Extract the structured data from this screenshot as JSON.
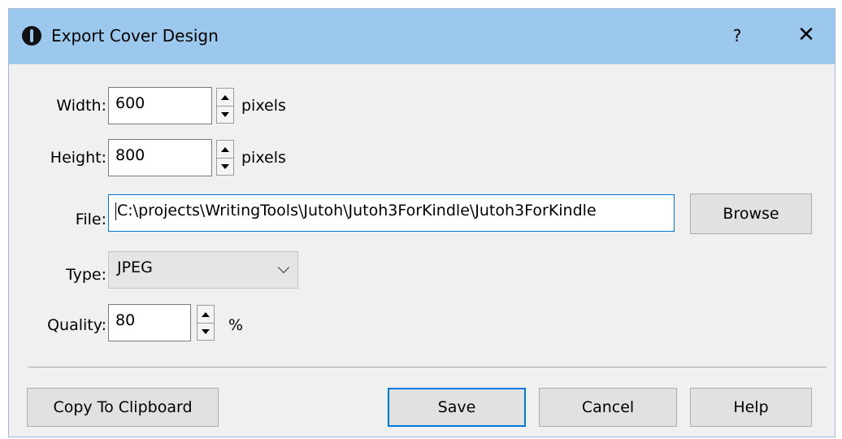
{
  "window": {
    "title": "Export Cover Design",
    "help_glyph": "?",
    "close_glyph": "✕",
    "app_icon": "info-icon"
  },
  "form": {
    "width": {
      "label": "Width:",
      "value": "600",
      "unit": "pixels"
    },
    "height": {
      "label": "Height:",
      "value": "800",
      "unit": "pixels"
    },
    "file": {
      "label": "File:",
      "value": "C:\\projects\\WritingTools\\Jutoh\\Jutoh3ForKindle\\Jutoh3ForKindle",
      "browse_label": "Browse"
    },
    "type": {
      "label": "Type:",
      "selected": "JPEG"
    },
    "quality": {
      "label": "Quality:",
      "value": "80",
      "unit": "%"
    }
  },
  "buttons": {
    "copy": "Copy To Clipboard",
    "save": "Save",
    "cancel": "Cancel",
    "help": "Help"
  },
  "colors": {
    "titlebar": "#9cc8ee",
    "dialog_bg": "#f0f0f0",
    "focus_accent": "#0078d7"
  }
}
